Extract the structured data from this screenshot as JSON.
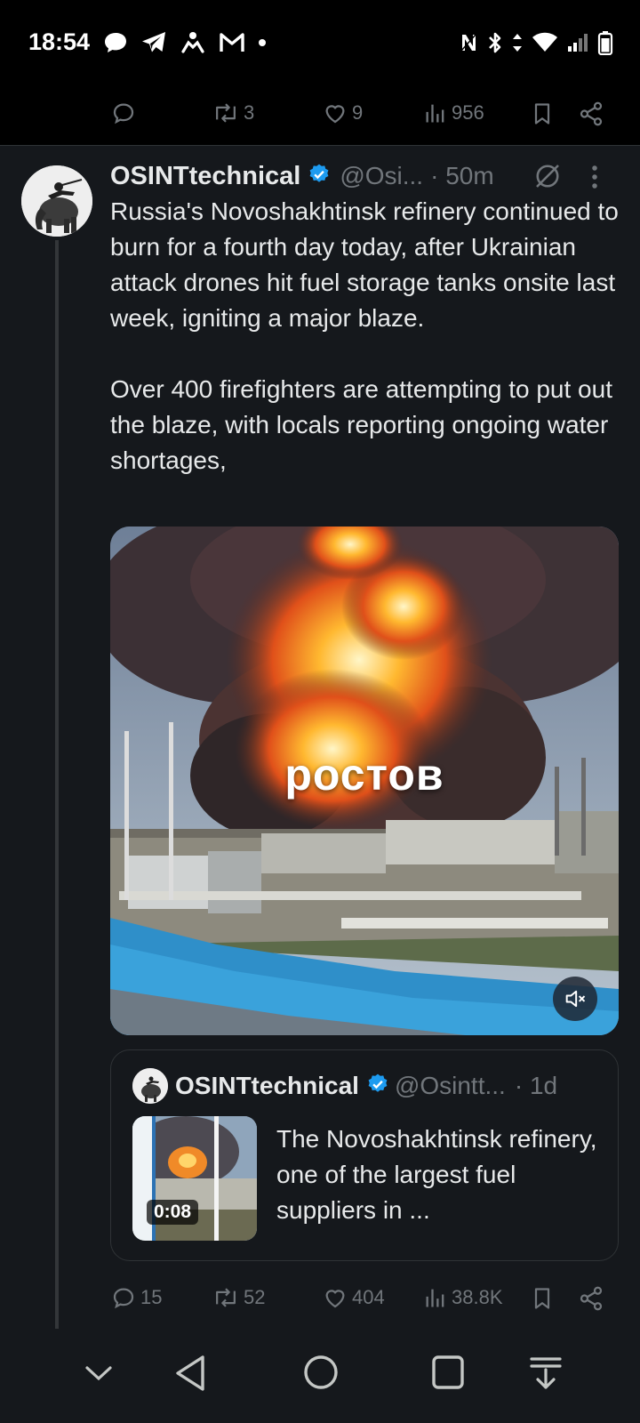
{
  "status_bar": {
    "time": "18:54",
    "left_icons": [
      "chat-bubble-icon",
      "telegram-icon",
      "activity-icon",
      "gmail-icon",
      "dot-icon"
    ],
    "right_icons": [
      "nfc-icon",
      "bluetooth-icon",
      "data-arrows-icon",
      "wifi-icon",
      "signal-icon",
      "battery-icon"
    ]
  },
  "previous_tweet": {
    "actions": {
      "reply_count": "",
      "retweet_count": "3",
      "like_count": "9",
      "view_count": "956"
    }
  },
  "tweet": {
    "author_name": "OSINTtechnical",
    "author_handle": "@Osi...",
    "time": "· 50m",
    "text_paragraph_1": "Russia's Novoshakhtinsk refinery continued to burn for a fourth day today, after Ukrainian attack drones hit fuel storage tanks onsite last week, igniting a major blaze.",
    "text_paragraph_2": "Over 400 firefighters are attempting to put out the blaze, with locals reporting ongoing water shortages,",
    "media": {
      "overlay_text": "ростов",
      "muted": true
    },
    "quoted": {
      "author_name": "OSINTtechnical",
      "author_handle": "@Osintt...",
      "time": "· 1d",
      "video_duration": "0:08",
      "text": "The Novoshakhtinsk refinery, one of the largest fuel suppliers in ..."
    },
    "actions": {
      "reply_count": "15",
      "retweet_count": "52",
      "like_count": "404",
      "view_count": "38.8K"
    }
  },
  "colors": {
    "background": "#000000",
    "tweet_bg": "#15181c",
    "text_primary": "#e7e9ea",
    "text_secondary": "#71767b",
    "verified_blue": "#1d9bf0"
  }
}
